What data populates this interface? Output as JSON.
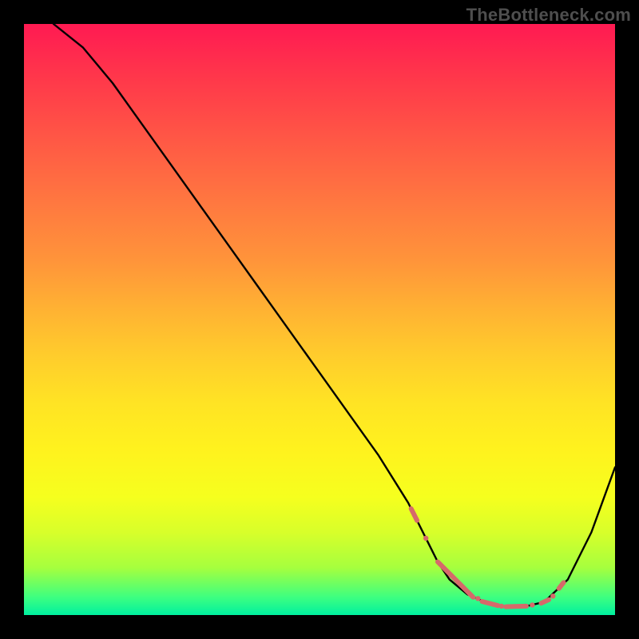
{
  "watermark": "TheBottleneck.com",
  "chart_data": {
    "type": "line",
    "title": "",
    "xlabel": "",
    "ylabel": "",
    "xlim": [
      0,
      100
    ],
    "ylim": [
      0,
      100
    ],
    "series": [
      {
        "name": "bottleneck-curve",
        "x": [
          5,
          10,
          15,
          20,
          25,
          30,
          35,
          40,
          45,
          50,
          55,
          60,
          65,
          68,
          70,
          72,
          75,
          78,
          80,
          82,
          85,
          88,
          92,
          96,
          100
        ],
        "y": [
          100,
          96,
          90,
          83,
          76,
          69,
          62,
          55,
          48,
          41,
          34,
          27,
          19,
          13,
          9,
          6,
          3.5,
          2.2,
          1.6,
          1.4,
          1.5,
          2.2,
          6,
          14,
          25
        ]
      }
    ],
    "markers": {
      "name": "optimal-range",
      "segments": [
        {
          "x0": 65.5,
          "y0": 18,
          "x1": 66.5,
          "y1": 16
        },
        {
          "x0": 70.0,
          "y0": 9,
          "x1": 76.0,
          "y1": 3
        },
        {
          "x0": 77.5,
          "y0": 2.3,
          "x1": 80.2,
          "y1": 1.6
        },
        {
          "x0": 81.5,
          "y0": 1.4,
          "x1": 85.0,
          "y1": 1.5
        },
        {
          "x0": 87.5,
          "y0": 2.0,
          "x1": 88.8,
          "y1": 2.6
        },
        {
          "x0": 90.5,
          "y0": 4.5,
          "x1": 91.3,
          "y1": 5.5
        }
      ],
      "dots": [
        {
          "x": 68.0,
          "y": 13.0
        },
        {
          "x": 76.8,
          "y": 2.8
        },
        {
          "x": 80.8,
          "y": 1.5
        },
        {
          "x": 86.0,
          "y": 1.7
        },
        {
          "x": 89.5,
          "y": 3.2
        }
      ]
    },
    "background": {
      "type": "vertical-gradient",
      "stops": [
        {
          "pos": 0,
          "color": "#ff1a52"
        },
        {
          "pos": 50,
          "color": "#ffb133"
        },
        {
          "pos": 80,
          "color": "#f6ff1e"
        },
        {
          "pos": 100,
          "color": "#00f0a0"
        }
      ]
    }
  }
}
